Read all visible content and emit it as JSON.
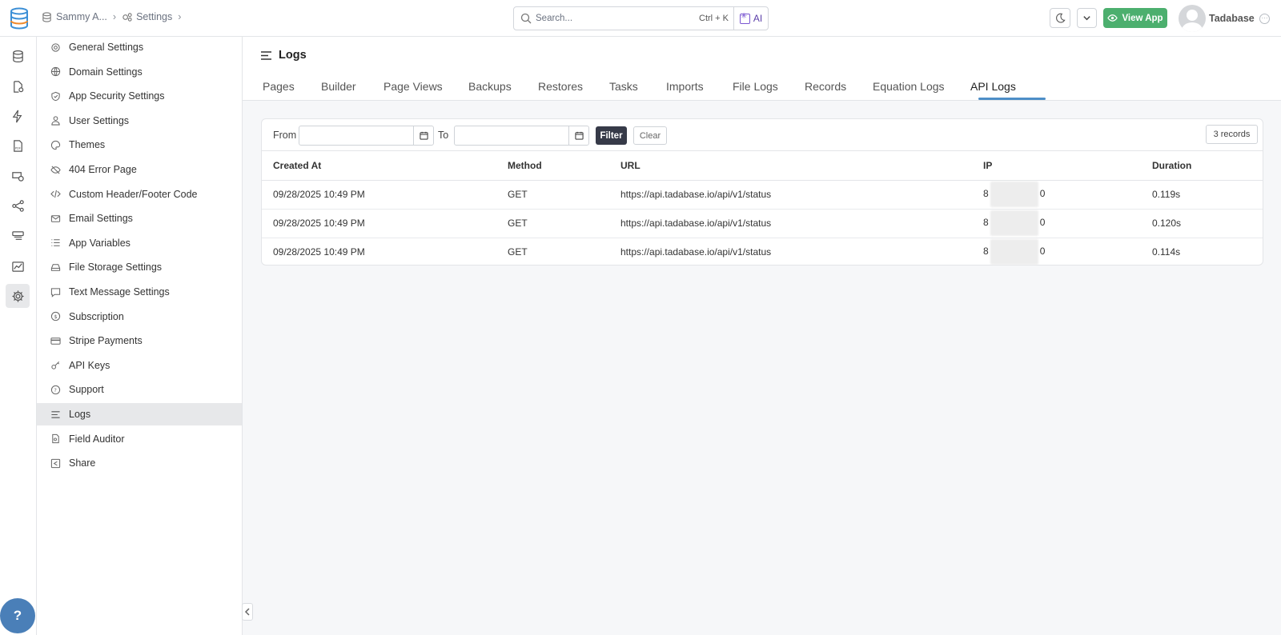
{
  "breadcrumb": {
    "app": "Sammy A...",
    "settings": "Settings"
  },
  "search": {
    "placeholder": "Search...",
    "shortcut": "Ctrl + K",
    "ai_label": "AI"
  },
  "header": {
    "view_app": "View App",
    "user": "Tadabase"
  },
  "sidebar": {
    "items": [
      {
        "label": "General Settings",
        "icon": "gear-icon"
      },
      {
        "label": "Domain Settings",
        "icon": "globe-icon"
      },
      {
        "label": "App Security Settings",
        "icon": "shield-icon"
      },
      {
        "label": "User Settings",
        "icon": "user-icon"
      },
      {
        "label": "Themes",
        "icon": "palette-icon"
      },
      {
        "label": "404 Error Page",
        "icon": "eye-slash-icon"
      },
      {
        "label": "Custom Header/Footer Code",
        "icon": "code-icon"
      },
      {
        "label": "Email Settings",
        "icon": "envelope-icon"
      },
      {
        "label": "App Variables",
        "icon": "list-icon"
      },
      {
        "label": "File Storage Settings",
        "icon": "drive-icon"
      },
      {
        "label": "Text Message Settings",
        "icon": "message-icon"
      },
      {
        "label": "Subscription",
        "icon": "dollar-circle-icon"
      },
      {
        "label": "Stripe Payments",
        "icon": "credit-card-icon"
      },
      {
        "label": "API Keys",
        "icon": "key-icon"
      },
      {
        "label": "Support",
        "icon": "question-circle-icon"
      },
      {
        "label": "Logs",
        "icon": "bars-icon"
      },
      {
        "label": "Field Auditor",
        "icon": "file-search-icon"
      },
      {
        "label": "Share",
        "icon": "share-icon"
      }
    ],
    "active": "Logs"
  },
  "page": {
    "title": "Logs"
  },
  "tabs": [
    "Pages",
    "Builder",
    "Page Views",
    "Backups",
    "Restores",
    "Tasks",
    "Imports",
    "File Logs",
    "Records",
    "Equation Logs",
    "API Logs"
  ],
  "active_tab": "API Logs",
  "filter": {
    "from_label": "From",
    "to_label": "To",
    "from_value": "",
    "to_value": "",
    "filter_button": "Filter",
    "clear_button": "Clear",
    "records_count": "3 records"
  },
  "table": {
    "columns": [
      "Created At",
      "Method",
      "URL",
      "IP",
      "Duration"
    ],
    "rows": [
      {
        "created_at": "09/28/2025 10:49 PM",
        "method": "GET",
        "url": "https://api.tadabase.io/api/v1/status",
        "ip_start": "8",
        "ip_end": "0",
        "duration": "0.119s"
      },
      {
        "created_at": "09/28/2025 10:49 PM",
        "method": "GET",
        "url": "https://api.tadabase.io/api/v1/status",
        "ip_start": "8",
        "ip_end": "0",
        "duration": "0.120s"
      },
      {
        "created_at": "09/28/2025 10:49 PM",
        "method": "GET",
        "url": "https://api.tadabase.io/api/v1/status",
        "ip_start": "8",
        "ip_end": "0",
        "duration": "0.114s"
      }
    ]
  },
  "help": {
    "label": "?"
  },
  "colors": {
    "accent": "#4d8ec7",
    "view_app": "#4caf6e",
    "filter_btn": "#363a48"
  }
}
